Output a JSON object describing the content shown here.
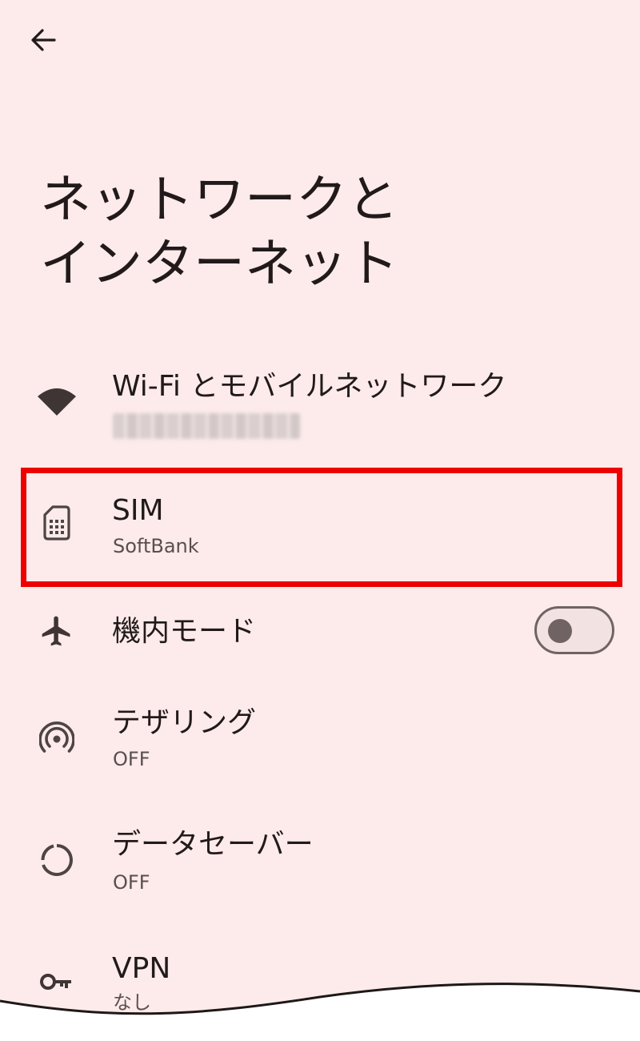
{
  "header": {
    "back_icon": "arrow-back-icon",
    "title_line1": "ネットワークと",
    "title_line2": "インターネット"
  },
  "items": [
    {
      "icon": "wifi-icon",
      "title": "Wi-Fi とモバイルネットワーク",
      "subtitle": ""
    },
    {
      "icon": "sim-card-icon",
      "title": "SIM",
      "subtitle": "SoftBank"
    },
    {
      "icon": "airplane-icon",
      "title": "機内モード",
      "toggle_on": false
    },
    {
      "icon": "hotspot-icon",
      "title": "テザリング",
      "subtitle": "OFF"
    },
    {
      "icon": "data-saver-icon",
      "title": "データセーバー",
      "subtitle": "OFF"
    },
    {
      "icon": "vpn-key-icon",
      "title": "VPN",
      "subtitle": "なし"
    }
  ],
  "colors": {
    "background": "#fcebea",
    "text": "#221a1a",
    "highlight": "#ee0000",
    "icon": "#4e4444"
  }
}
